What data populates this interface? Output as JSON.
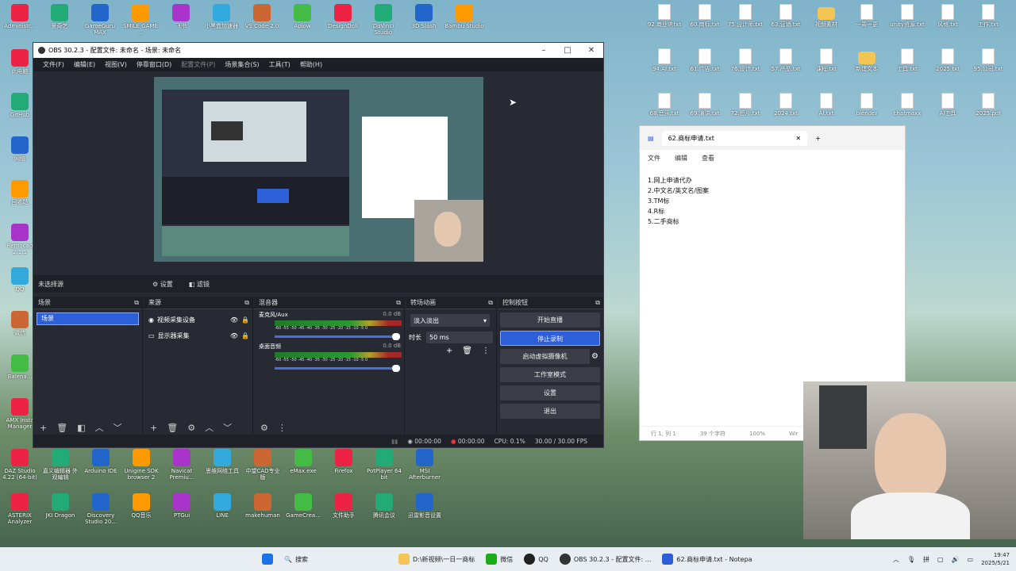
{
  "desktop": {
    "top_row": [
      "Administr...",
      "爱奇艺",
      "GameGuru MAX",
      "SMILE GAME ...",
      "飞书",
      "小黑盒加速器",
      "VS Code 2.0",
      "Aplow",
      "DesignDoll",
      "DaVinci Studio",
      "3D Slash",
      "Bambu Studio"
    ],
    "left_col": [
      "此电脑",
      "GitHub",
      "网络",
      "回收站",
      "Remocap 2.1.1",
      "QQ",
      "微信",
      "Balena...",
      "AMX Insta Manager"
    ],
    "bottom_row1": [
      "DAZ Studio 4.22 (64-bit)",
      "嘉义编辑器 外观编辑",
      "Arduino IDE",
      "Unigine SDK browser 2",
      "Navicat Premiu...",
      "思维网络工具",
      "中望CAD专业版",
      "eMax.exe",
      "Firefox",
      "PotPlayer 64 bit",
      "MSI Afterburner"
    ],
    "bottom_row2": [
      "ASTERIX Analyzer",
      "JKI Dragon",
      "Discovery Studio 20...",
      "QQ音乐",
      "PTGui",
      "LINE",
      "makehuman",
      "GameCrea...",
      "文件助手",
      "腾讯会议",
      "迅雷影音设置"
    ],
    "right_files": [
      "92.商业IP.txt",
      "60.商标.txt",
      "75.设计师.txt",
      "63.营销.txt",
      "视频素材",
      "一周一更",
      "unity资源.txt",
      "风格.txt",
      "工作.txt",
      "94.AI.txt",
      "61.广告.txt",
      "76.设计.txt",
      "57.产品.txt",
      "课程.txt",
      "新建文本",
      "工具.txt",
      "2025.txt",
      "95.公司.txt",
      "68.音乐.txt",
      "69.演讲.txt",
      "72.图片.txt",
      "2024.txt",
      "AI.txt",
      "blender",
      "chatmaxx",
      "AI工具",
      "2025.pdf"
    ]
  },
  "obs": {
    "title": "OBS 30.2.3 - 配置文件: 未命名 - 场景: 未命名",
    "menu": [
      "文件(F)",
      "编辑(E)",
      "视图(V)",
      "停靠窗口(D)",
      "配置文件(P)",
      "场景集合(S)",
      "工具(T)",
      "帮助(H)"
    ],
    "no_source": "未选择源",
    "props_btn": "设置",
    "filters_btn": "滤镜",
    "scenes_title": "场景",
    "scene_item": "场景",
    "sources_title": "来源",
    "sources": [
      {
        "name": "视频采集设备"
      },
      {
        "name": "显示器采集"
      }
    ],
    "mixer_title": "混音器",
    "mixer": [
      {
        "name": "麦克风/Aux",
        "db": "0.0 dB",
        "scale": "-60 -55 -50 -45 -40 -35 -30 -25 -20 -15 -10 -5 0"
      },
      {
        "name": "桌面音频",
        "db": "0.0 dB",
        "scale": "-60 -55 -50 -45 -40 -35 -30 -25 -20 -15 -10 -5 0"
      }
    ],
    "transitions_title": "转场动画",
    "transition_select": "淡入淡出",
    "duration_label": "时长",
    "duration_value": "50 ms",
    "controls_title": "控制按钮",
    "controls": [
      "开始直播",
      "停止录制",
      "启动虚拟摄像机",
      "工作室模式",
      "设置",
      "退出"
    ],
    "status": {
      "live": "00:00:00",
      "rec": "00:00:00",
      "cpu": "CPU: 0.1%",
      "fps": "30.00 / 30.00 FPS"
    }
  },
  "notepad": {
    "tab_title": "62.商标申请.txt",
    "menu": [
      "文件",
      "编辑",
      "查看"
    ],
    "lines": [
      "1.网上申请代办",
      "2.中文名/英文名/图案",
      "3.TM标",
      "4.R标",
      "5.二手商标"
    ],
    "status": [
      "行 1, 列 1",
      "39 个字符",
      "100%",
      "Wir"
    ]
  },
  "taskbar": {
    "search": "搜索",
    "items": [
      "D:\\新视频\\一日一商标",
      "微信",
      "QQ",
      "OBS 30.2.3 - 配置文件: ...",
      "62.商标申请.txt - Notepa"
    ],
    "tray_lang": "拼",
    "time": "19:47",
    "date": "2025/5/21"
  },
  "colors": {
    "accent": "#2d5fd8",
    "obs_bg": "#272a33"
  }
}
